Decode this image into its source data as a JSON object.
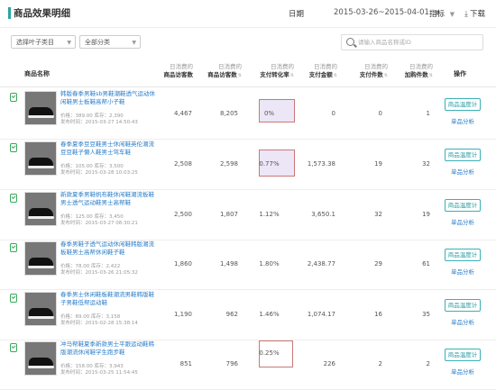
{
  "header": {
    "title": "商品效果明细",
    "date_label": "日期",
    "date_range": "2015-03-26~2015-04-01",
    "metrics_label": "指标",
    "download_label": "下载"
  },
  "filters": {
    "category_select": "选择叶子类目",
    "status_select": "全部分类",
    "search_placeholder": "请输入商品名称或ID"
  },
  "table": {
    "columns": {
      "name": "商品名称",
      "visitors": {
        "prefix": "日消费的",
        "label": "商品访客数"
      },
      "views": {
        "prefix": "日消费的",
        "label": "商品访客数"
      },
      "conversion": {
        "prefix": "日消费的",
        "label": "支付转化率"
      },
      "amount": {
        "prefix": "日消费的",
        "label": "支付金额"
      },
      "paid_items": {
        "prefix": "日消费的",
        "label": "支付件数"
      },
      "cart_items": {
        "prefix": "日消费的",
        "label": "加购件数"
      },
      "op": "操作"
    },
    "rows": [
      {
        "name": "韩版春季男鞋sb男鞋潮鞋透气运动休闲鞋男士板鞋高帮小子鞋",
        "price": "价格：389.00  库存：2,390",
        "published": "发布时间：2015-03-27 14:50:43",
        "visitors": "4,467",
        "views": "8,205",
        "conversion": "0%",
        "amount": "0",
        "paid_items": "0",
        "cart_items": "1",
        "btn": "商品温度计",
        "link": "单品分析"
      },
      {
        "name": "春季夏季豆豆鞋男士休闲鞋英伦潮流豆豆鞋子懒人鞋男士驾车鞋",
        "price": "价格：105.00  库存：3,500",
        "published": "发布时间：2015-03-28 10:03:25",
        "visitors": "2,508",
        "views": "2,598",
        "conversion": "0.77%",
        "amount": "1,573.38",
        "paid_items": "19",
        "cart_items": "32",
        "btn": "商品温度计",
        "link": "单品分析"
      },
      {
        "name": "新款夏季男鞋帆布鞋休闲鞋潮流板鞋男士透气运动鞋男士高帮鞋",
        "price": "价格：125.00  库存：3,450",
        "published": "发布时间：2015-03-27 08:30:21",
        "visitors": "2,500",
        "views": "1,807",
        "conversion": "1.12%",
        "amount": "3,650.1",
        "paid_items": "32",
        "cart_items": "19",
        "btn": "商品温度计",
        "link": "单品分析"
      },
      {
        "name": "春季男鞋子透气运动休闲鞋韩版潮流板鞋男士高帮休闲鞋子鞋",
        "price": "价格：78.00  库存：2,422",
        "published": "发布时间：2015-03-26 21:05:32",
        "visitors": "1,860",
        "views": "1,498",
        "conversion": "1.80%",
        "amount": "2,438.77",
        "paid_items": "29",
        "cart_items": "61",
        "btn": "商品温度计",
        "link": "单品分析"
      },
      {
        "name": "春季男士休闲鞋板鞋潮流男鞋韩版鞋子男鞋低帮运动鞋",
        "price": "价格：89.00  库存：3,158",
        "published": "发布时间：2015-02-28 15:38:14",
        "visitors": "1,190",
        "views": "962",
        "conversion": "1.46%",
        "amount": "1,074.17",
        "paid_items": "16",
        "cart_items": "35",
        "btn": "商品温度计",
        "link": "单品分析"
      },
      {
        "name": "冲马帮鞋夏季新款男士平跟运动鞋韩版潮流休闲鞋学生跑步鞋",
        "price": "价格：158.00  库存：3,943",
        "published": "发布时间：2015-03-25 11:54:45",
        "visitors": "851",
        "views": "796",
        "conversion": "0.25%",
        "amount": "226",
        "paid_items": "2",
        "cart_items": "2",
        "btn": "商品温度计",
        "link": "单品分析"
      }
    ]
  },
  "colors": {
    "accent": "#2aa3a8",
    "link": "#2a7dc9",
    "check": "#3aa85a",
    "highlight_fill": "#ece6f6",
    "highlight_border": "#c77"
  }
}
